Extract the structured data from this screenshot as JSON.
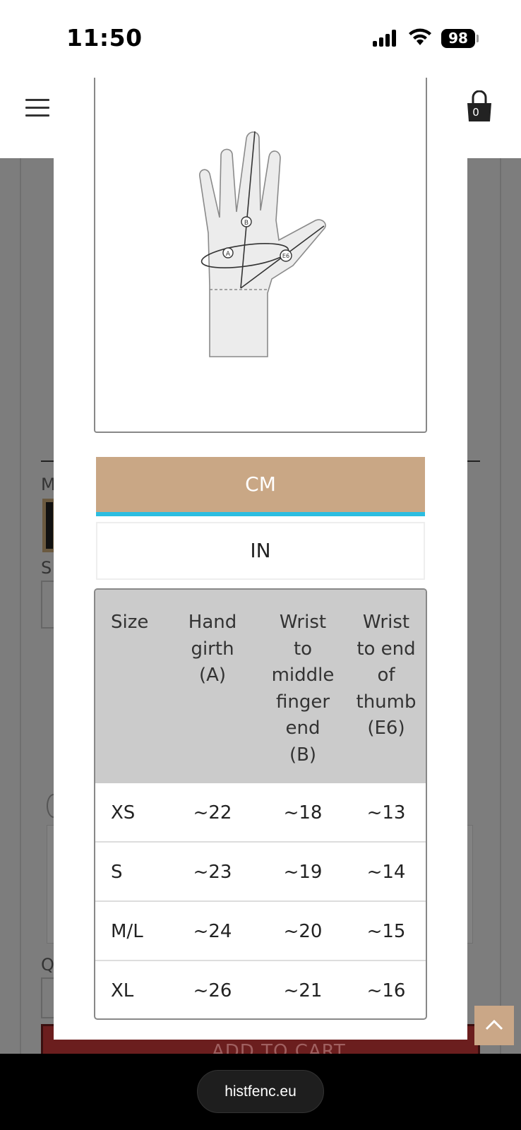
{
  "status_bar": {
    "time": "11:50",
    "battery": "98"
  },
  "header": {
    "cart_count": "0",
    "icons": [
      "hamburger-menu-icon",
      "shopping-bag-icon"
    ]
  },
  "background_page": {
    "letters": [
      "M",
      "S",
      "Q"
    ],
    "add_to_cart_label": "ADD TO CART"
  },
  "modal": {
    "illustration": "hand-measurement-diagram",
    "diagram_labels": [
      "A",
      "B",
      "E6"
    ],
    "tabs": [
      {
        "label": "CM",
        "active": true
      },
      {
        "label": "IN",
        "active": false
      }
    ],
    "table": {
      "headers": {
        "size": "Size",
        "a_lines": [
          "Hand",
          "girth",
          "(A)"
        ],
        "b_lines": [
          "Wrist",
          "to",
          "middle",
          "finger",
          "end",
          "(B)"
        ],
        "e6_lines": [
          "Wrist",
          "to end",
          "of",
          "thumb",
          "(E6)"
        ]
      },
      "rows": [
        {
          "size": "XS",
          "a": "~22",
          "b": "~18",
          "e6": "~13"
        },
        {
          "size": "S",
          "a": "~23",
          "b": "~19",
          "e6": "~14"
        },
        {
          "size": "M/L",
          "a": "~24",
          "b": "~20",
          "e6": "~15"
        },
        {
          "size": "XL",
          "a": "~26",
          "b": "~21",
          "e6": "~16"
        }
      ]
    }
  },
  "browser": {
    "url": "histfenc.eu"
  },
  "colors": {
    "active_tab": "#c9a785",
    "active_tab_underline": "#2cbde0",
    "table_header": "#cbcbcb",
    "add_to_cart": "#6b1e1e",
    "scroll_top_button": "#caa787"
  }
}
